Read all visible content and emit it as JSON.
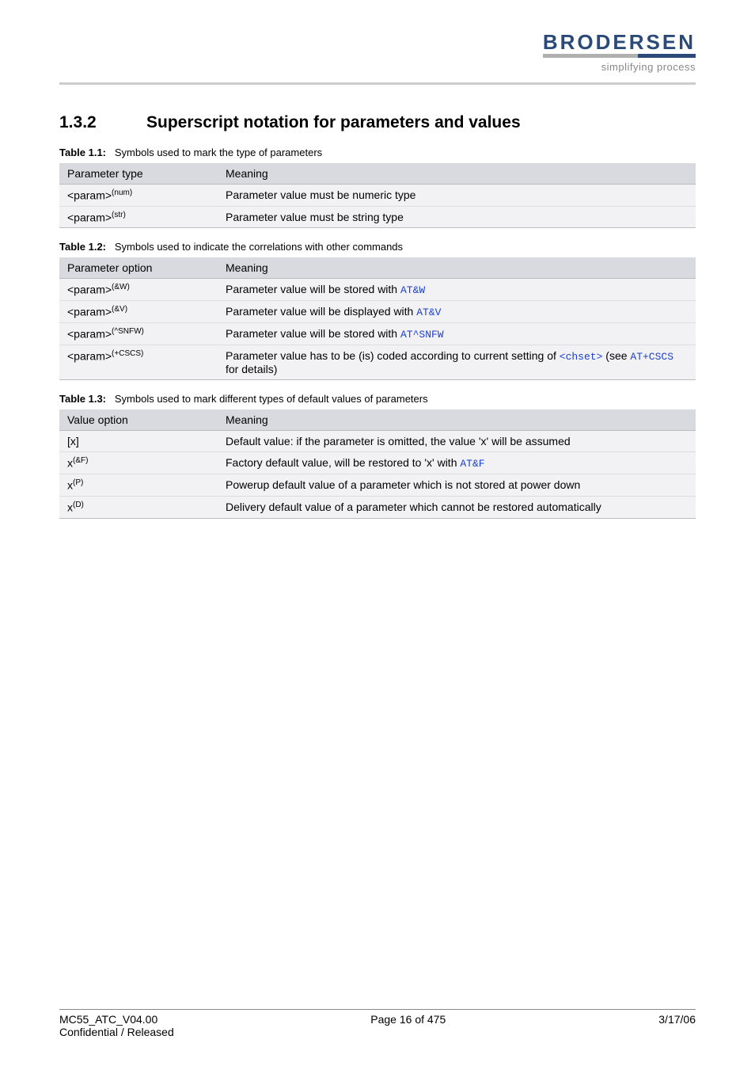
{
  "header": {
    "logo": "BRODERSEN",
    "tagline": "simplifying process"
  },
  "section": {
    "number": "1.3.2",
    "title": "Superscript notation for parameters and values"
  },
  "tables": [
    {
      "label": "Table 1.1:",
      "caption": "Symbols used to mark the type of parameters",
      "head": [
        "Parameter type",
        "Meaning"
      ],
      "rows": [
        {
          "c1_base": "<param>",
          "c1_sup": "(num)",
          "c2": [
            {
              "t": "Parameter value must be numeric type"
            }
          ]
        },
        {
          "c1_base": "<param>",
          "c1_sup": "(str)",
          "c2": [
            {
              "t": "Parameter value must be string type"
            }
          ]
        }
      ]
    },
    {
      "label": "Table 1.2:",
      "caption": "Symbols used to indicate the correlations with other commands",
      "head": [
        "Parameter option",
        "Meaning"
      ],
      "rows": [
        {
          "c1_base": "<param>",
          "c1_sup": "(&W)",
          "c2": [
            {
              "t": "Parameter value will be stored with "
            },
            {
              "t": "AT&W",
              "cls": "code link"
            }
          ]
        },
        {
          "c1_base": "<param>",
          "c1_sup": "(&V)",
          "c2": [
            {
              "t": "Parameter value will be displayed with "
            },
            {
              "t": "AT&V",
              "cls": "code link"
            }
          ]
        },
        {
          "c1_base": "<param>",
          "c1_sup": "(^SNFW)",
          "c2": [
            {
              "t": "Parameter value will be stored with "
            },
            {
              "t": "AT^SNFW",
              "cls": "code link"
            }
          ]
        },
        {
          "c1_base": "<param>",
          "c1_sup": "(+CSCS)",
          "c2": [
            {
              "t": "Parameter value has to be (is) coded according to current setting of "
            },
            {
              "t": "<chset>",
              "cls": "code link"
            },
            {
              "t": " (see "
            },
            {
              "t": "AT+CSCS",
              "cls": "code link"
            },
            {
              "t": " for details)"
            }
          ]
        }
      ]
    },
    {
      "label": "Table 1.3:",
      "caption": "Symbols used to mark different types of default values of parameters",
      "head": [
        "Value option",
        "Meaning"
      ],
      "rows": [
        {
          "c1_base": "[x]",
          "c1_sup": "",
          "c2": [
            {
              "t": "Default value: if the parameter is omitted, the value 'x' will be assumed"
            }
          ]
        },
        {
          "c1_base": "x",
          "c1_sup": "(&F)",
          "c2": [
            {
              "t": "Factory default value, will be restored to 'x' with "
            },
            {
              "t": "AT&F",
              "cls": "code link"
            }
          ]
        },
        {
          "c1_base": "x",
          "c1_sup": "(P)",
          "c2": [
            {
              "t": "Powerup default value of a parameter which is not stored at power down"
            }
          ]
        },
        {
          "c1_base": "x",
          "c1_sup": "(D)",
          "c2": [
            {
              "t": "Delivery default value of a parameter which cannot be restored automatically"
            }
          ]
        }
      ]
    }
  ],
  "footer": {
    "left1": "MC55_ATC_V04.00",
    "center": "Page 16 of 475",
    "right": "3/17/06",
    "left2": "Confidential / Released"
  }
}
